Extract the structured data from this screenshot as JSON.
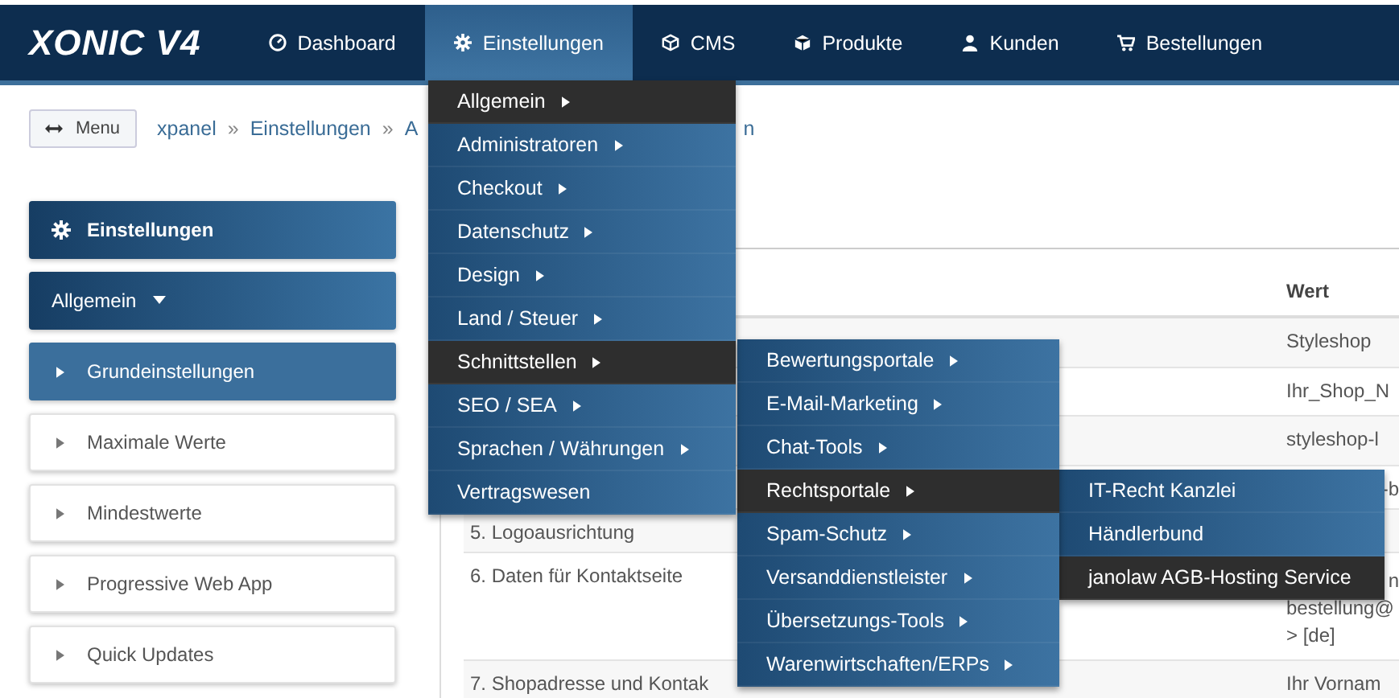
{
  "navbar": {
    "logo": "XONIC V4",
    "items": [
      {
        "label": "Dashboard",
        "selected": false
      },
      {
        "label": "Einstellungen",
        "selected": true
      },
      {
        "label": "CMS",
        "selected": false
      },
      {
        "label": "Produkte",
        "selected": false
      },
      {
        "label": "Kunden",
        "selected": false
      },
      {
        "label": "Bestellungen",
        "selected": false
      }
    ]
  },
  "menu_button": "Menu",
  "breadcrumb": {
    "items": [
      "xpanel",
      "Einstellungen",
      "A"
    ],
    "separator": "»",
    "tail": "n"
  },
  "dropdown": [
    {
      "label": "Allgemein",
      "arrow": true,
      "selected": true
    },
    {
      "label": "Administratoren",
      "arrow": true,
      "selected": false
    },
    {
      "label": "Checkout",
      "arrow": true,
      "selected": false
    },
    {
      "label": "Datenschutz",
      "arrow": true,
      "selected": false
    },
    {
      "label": "Design",
      "arrow": true,
      "selected": false
    },
    {
      "label": "Land / Steuer",
      "arrow": true,
      "selected": false
    },
    {
      "label": "Schnittstellen",
      "arrow": true,
      "selected": true,
      "children": [
        {
          "label": "Bewertungsportale",
          "arrow": true,
          "selected": false
        },
        {
          "label": "E-Mail-Marketing",
          "arrow": true,
          "selected": false
        },
        {
          "label": "Chat-Tools",
          "arrow": true,
          "selected": false
        },
        {
          "label": "Rechtsportale",
          "arrow": true,
          "selected": true,
          "children": [
            {
              "label": "IT-Recht Kanzlei",
              "arrow": false,
              "selected": false
            },
            {
              "label": "Händlerbund",
              "arrow": false,
              "selected": false
            },
            {
              "label": "janolaw AGB-Hosting Service",
              "arrow": false,
              "selected": true
            }
          ]
        },
        {
          "label": "Spam-Schutz",
          "arrow": true,
          "selected": false
        },
        {
          "label": "Versanddienstleister",
          "arrow": true,
          "selected": false
        },
        {
          "label": "Übersetzungs-Tools",
          "arrow": true,
          "selected": false
        },
        {
          "label": "Warenwirtschaften/ERPs",
          "arrow": true,
          "selected": false
        }
      ]
    },
    {
      "label": "SEO / SEA",
      "arrow": true,
      "selected": false
    },
    {
      "label": "Sprachen / Währungen",
      "arrow": true,
      "selected": false
    },
    {
      "label": "Vertragswesen",
      "arrow": false,
      "selected": false
    }
  ],
  "sidebar": {
    "title": "Einstellungen",
    "group": "Allgemein",
    "items": [
      {
        "label": "Grundeinstellungen",
        "selected": true
      },
      {
        "label": "Maximale Werte",
        "selected": false
      },
      {
        "label": "Mindestwerte",
        "selected": false
      },
      {
        "label": "Progressive Web App",
        "selected": false
      },
      {
        "label": "Quick Updates",
        "selected": false
      }
    ]
  },
  "table": {
    "columns": [
      "Wert"
    ],
    "rows": [
      {
        "value": [
          "Styleshop"
        ]
      },
      {
        "value": [
          "Ihr_Shop_N"
        ]
      },
      {
        "value": [
          "styleshop-l"
        ]
      },
      {
        "value": [
          "-b"
        ]
      },
      {
        "name": "5. Logoausrichtung"
      },
      {
        "name": "6. Daten für Kontaktseite",
        "value": [
          "n",
          "bestellung@",
          "> [de]"
        ]
      },
      {
        "name": "7. Shopadresse und Kontak",
        "value": [
          "Ihr Vornam"
        ]
      }
    ]
  }
}
